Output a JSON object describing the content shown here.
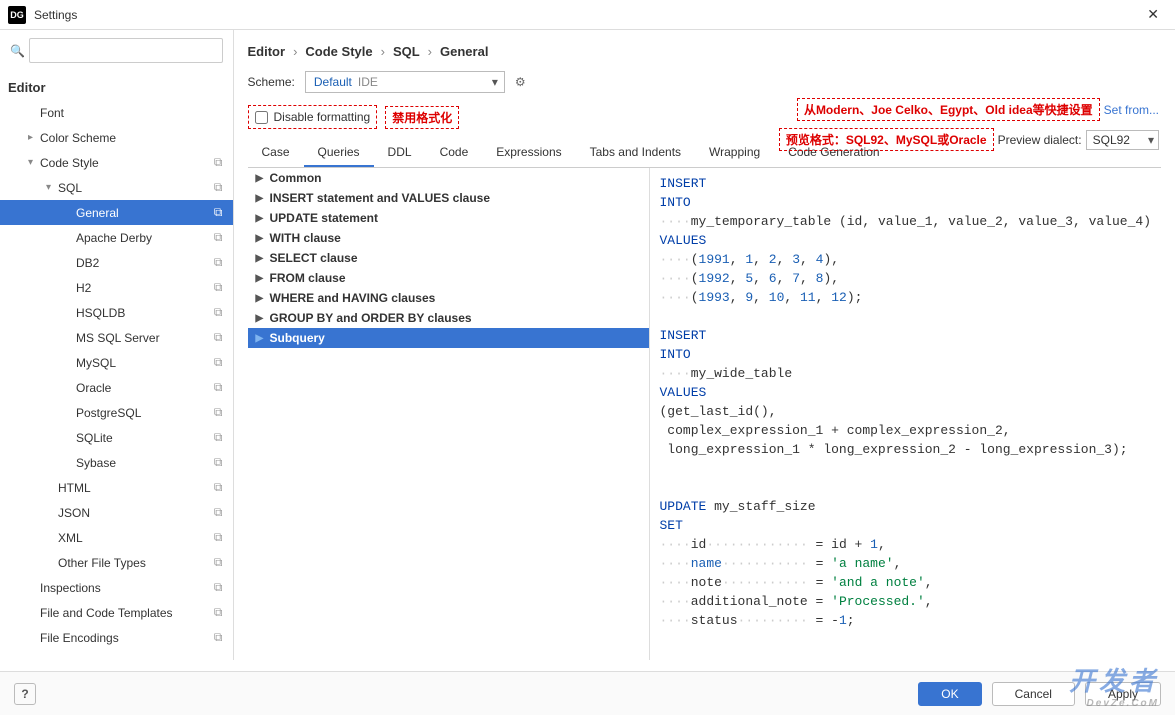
{
  "window": {
    "title": "Settings",
    "icon": "DG"
  },
  "search": {
    "placeholder": ""
  },
  "tree": {
    "root": "Editor",
    "items": [
      {
        "label": "Font",
        "indent": "ind1",
        "arrow": "",
        "copy": false
      },
      {
        "label": "Color Scheme",
        "indent": "ind1",
        "arrow": "▸",
        "copy": false
      },
      {
        "label": "Code Style",
        "indent": "ind1",
        "arrow": "▾",
        "copy": true
      },
      {
        "label": "SQL",
        "indent": "ind2",
        "arrow": "▾",
        "copy": true
      },
      {
        "label": "General",
        "indent": "ind3",
        "arrow": "",
        "copy": true,
        "selected": true
      },
      {
        "label": "Apache Derby",
        "indent": "ind3",
        "arrow": "",
        "copy": true
      },
      {
        "label": "DB2",
        "indent": "ind3",
        "arrow": "",
        "copy": true
      },
      {
        "label": "H2",
        "indent": "ind3",
        "arrow": "",
        "copy": true
      },
      {
        "label": "HSQLDB",
        "indent": "ind3",
        "arrow": "",
        "copy": true
      },
      {
        "label": "MS SQL Server",
        "indent": "ind3",
        "arrow": "",
        "copy": true
      },
      {
        "label": "MySQL",
        "indent": "ind3",
        "arrow": "",
        "copy": true
      },
      {
        "label": "Oracle",
        "indent": "ind3",
        "arrow": "",
        "copy": true
      },
      {
        "label": "PostgreSQL",
        "indent": "ind3",
        "arrow": "",
        "copy": true
      },
      {
        "label": "SQLite",
        "indent": "ind3",
        "arrow": "",
        "copy": true
      },
      {
        "label": "Sybase",
        "indent": "ind3",
        "arrow": "",
        "copy": true
      },
      {
        "label": "HTML",
        "indent": "ind2",
        "arrow": "",
        "copy": true
      },
      {
        "label": "JSON",
        "indent": "ind2",
        "arrow": "",
        "copy": true
      },
      {
        "label": "XML",
        "indent": "ind2",
        "arrow": "",
        "copy": true
      },
      {
        "label": "Other File Types",
        "indent": "ind2",
        "arrow": "",
        "copy": true
      },
      {
        "label": "Inspections",
        "indent": "ind1",
        "arrow": "",
        "copy": true
      },
      {
        "label": "File and Code Templates",
        "indent": "ind1",
        "arrow": "",
        "copy": true
      },
      {
        "label": "File Encodings",
        "indent": "ind1",
        "arrow": "",
        "copy": true
      }
    ]
  },
  "breadcrumb": {
    "a": "Editor",
    "b": "Code Style",
    "c": "SQL",
    "d": "General"
  },
  "scheme": {
    "label": "Scheme:",
    "value_default": "Default",
    "value_ide": "IDE"
  },
  "disable": {
    "label": "Disable formatting",
    "annot": "禁用格式化"
  },
  "annot_top": {
    "text": "从Modern、Joe Celko、Egypt、Old idea等快捷设置",
    "link": "Set from..."
  },
  "annot_mid": {
    "text": "预览格式：SQL92、MySQL或Oracle",
    "label": "Preview dialect:",
    "value": "SQL92"
  },
  "tabs": [
    "Case",
    "Queries",
    "DDL",
    "Code",
    "Expressions",
    "Tabs and Indents",
    "Wrapping",
    "Code Generation"
  ],
  "active_tab": 1,
  "sections": [
    "Common",
    "INSERT statement and VALUES clause",
    "UPDATE statement",
    "WITH clause",
    "SELECT clause",
    "FROM clause",
    "WHERE and HAVING clauses",
    "GROUP BY and ORDER BY clauses",
    "Subquery"
  ],
  "selected_section": 8,
  "buttons": {
    "ok": "OK",
    "cancel": "Cancel",
    "apply": "Apply"
  },
  "watermark": {
    "main": "开发者",
    "sub": "DevZe.CoM"
  }
}
